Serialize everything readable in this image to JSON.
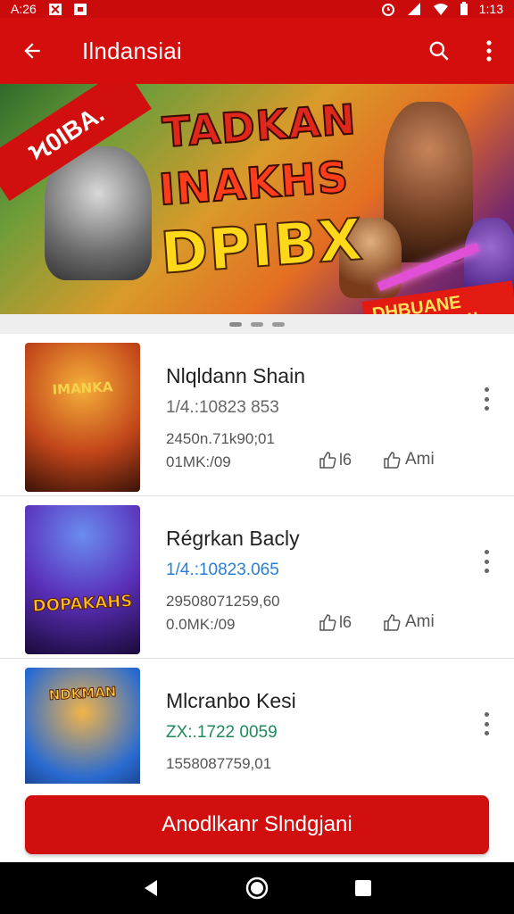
{
  "status_bar": {
    "time_left": "A:26",
    "time_right": "1:13"
  },
  "app_bar": {
    "title": "Ilndansiai"
  },
  "banner": {
    "flag_text": "Ϟ0IBA.",
    "line1": "TADKAN",
    "line2": "INAKHS",
    "line3": "DPIBX",
    "badge": "DHBUANE NEEKINRA!!"
  },
  "carousel": {
    "page_count": 3,
    "active_index": 0
  },
  "games": [
    {
      "name": "Nlqldann Shain",
      "code": "1/4.:10823 853",
      "code_color": "#666666",
      "line1": "2450n.71k90;01",
      "line2": "01MK:/09",
      "likes": "l6",
      "share": "Ami",
      "thumb_text": "IMANKA"
    },
    {
      "name": "Régrkan Bacly",
      "code": "1/4.:10823.065",
      "code_color": "#2a7fd4",
      "line1": "29508071259,60",
      "line2": "0.0MK:/09",
      "likes": "l6",
      "share": "Ami",
      "thumb_text": "DOPAKAHS"
    },
    {
      "name": "Mlcranbo Kesi",
      "code": "ZX:.1722 0059",
      "code_color": "#1e8a5a",
      "line1": "1558087759,01",
      "line2": "",
      "likes": "",
      "share": "",
      "thumb_text": "NDKMAN"
    }
  ],
  "cta": {
    "label": "Anodlkanr Slndgjani"
  },
  "colors": {
    "primary": "#d40d0d",
    "statusbar": "#c90b0b"
  }
}
